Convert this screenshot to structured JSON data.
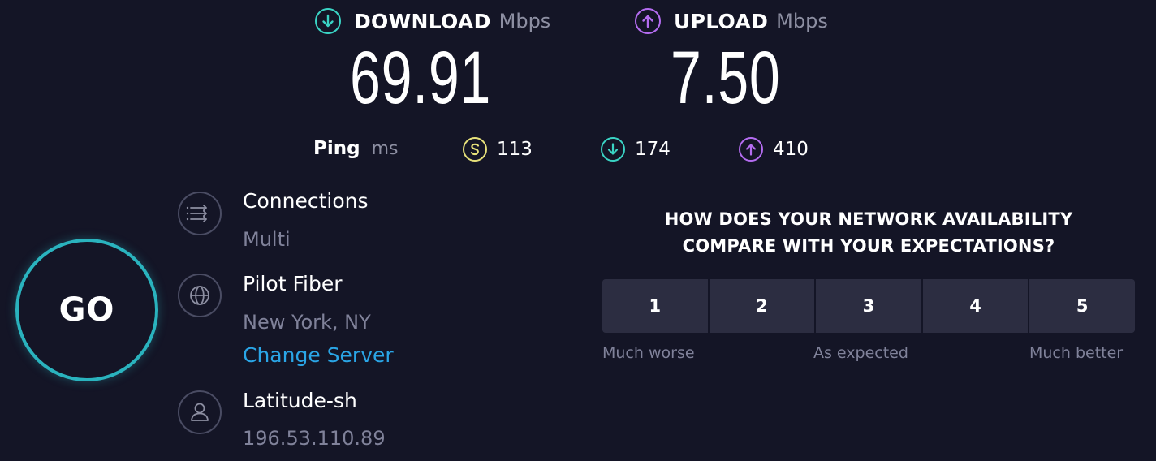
{
  "download": {
    "label": "DOWNLOAD",
    "unit": "Mbps",
    "value": "69.91",
    "icon": "download-arrow-icon"
  },
  "upload": {
    "label": "UPLOAD",
    "unit": "Mbps",
    "value": "7.50",
    "icon": "upload-arrow-icon"
  },
  "ping": {
    "label": "Ping",
    "unit": "ms",
    "idle": "113",
    "download": "174",
    "upload": "410"
  },
  "go_label": "GO",
  "connections": {
    "title": "Connections",
    "value": "Multi",
    "icon": "connections-icon"
  },
  "server": {
    "title": "Pilot Fiber",
    "location": "New York, NY",
    "change_link": "Change Server",
    "icon": "globe-icon"
  },
  "provider": {
    "title": "Latitude-sh",
    "ip": "196.53.110.89",
    "icon": "user-icon"
  },
  "survey": {
    "question_line1": "HOW DOES YOUR NETWORK AVAILABILITY",
    "question_line2": "COMPARE WITH YOUR EXPECTATIONS?",
    "options": [
      "1",
      "2",
      "3",
      "4",
      "5"
    ],
    "low_label": "Much worse",
    "mid_label": "As expected",
    "high_label": "Much better"
  },
  "colors": {
    "background": "#141526",
    "download_accent": "#3ad3c4",
    "upload_accent": "#b46cf0",
    "ping_accent": "#e6e07a",
    "go_ring": "#2ab3be",
    "link": "#2aa5e6"
  }
}
